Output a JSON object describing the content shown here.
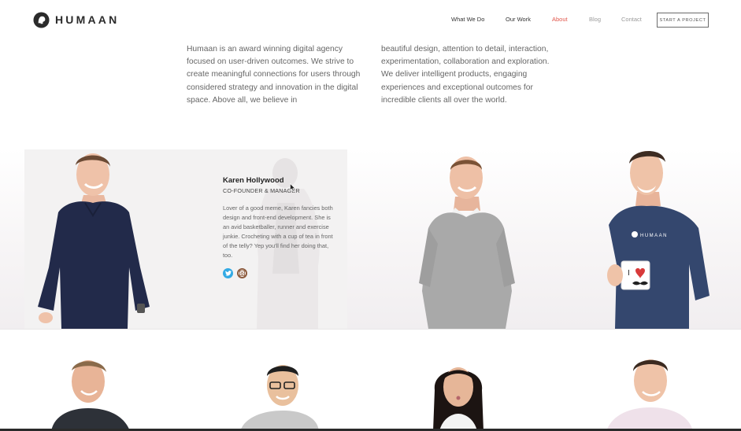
{
  "header": {
    "brand": "HUMAAN",
    "nav": [
      {
        "label": "What We Do",
        "state": "default"
      },
      {
        "label": "Our Work",
        "state": "default"
      },
      {
        "label": "About",
        "state": "active"
      },
      {
        "label": "Blog",
        "state": "muted"
      },
      {
        "label": "Contact",
        "state": "muted"
      }
    ],
    "cta_label": "START A PROJECT"
  },
  "intro": {
    "left": "Humaan is an award winning digital agency focused on user-driven outcomes. We strive to create meaningful connections for users through considered strategy and innovation in the digital space. Above all, we believe in",
    "right": "beautiful design, attention to detail, interaction, experimentation, collaboration and exploration. We deliver intelligent products, engaging experiences and exceptional outcomes for incredible clients all over the world."
  },
  "bio": {
    "name": "Karen Hollywood",
    "role": "CO-FOUNDER & MANAGER",
    "text": "Lover of a good meme, Karen fancies both design and front-end development. She is an avid basketballer, runner and exercise junkie. Crocheting with a cup of tea in front of the telly? Yep you'll find her doing that, too.",
    "social": [
      "twitter-icon",
      "dribbble-icon"
    ]
  },
  "shirt_logo": "HUMAAN",
  "colors": {
    "accent": "#e2574c",
    "twitter": "#33aae4",
    "navy_shirt": "#222a4a",
    "tee_blue": "#34476e",
    "grey_sweater": "#a9a9a9"
  }
}
